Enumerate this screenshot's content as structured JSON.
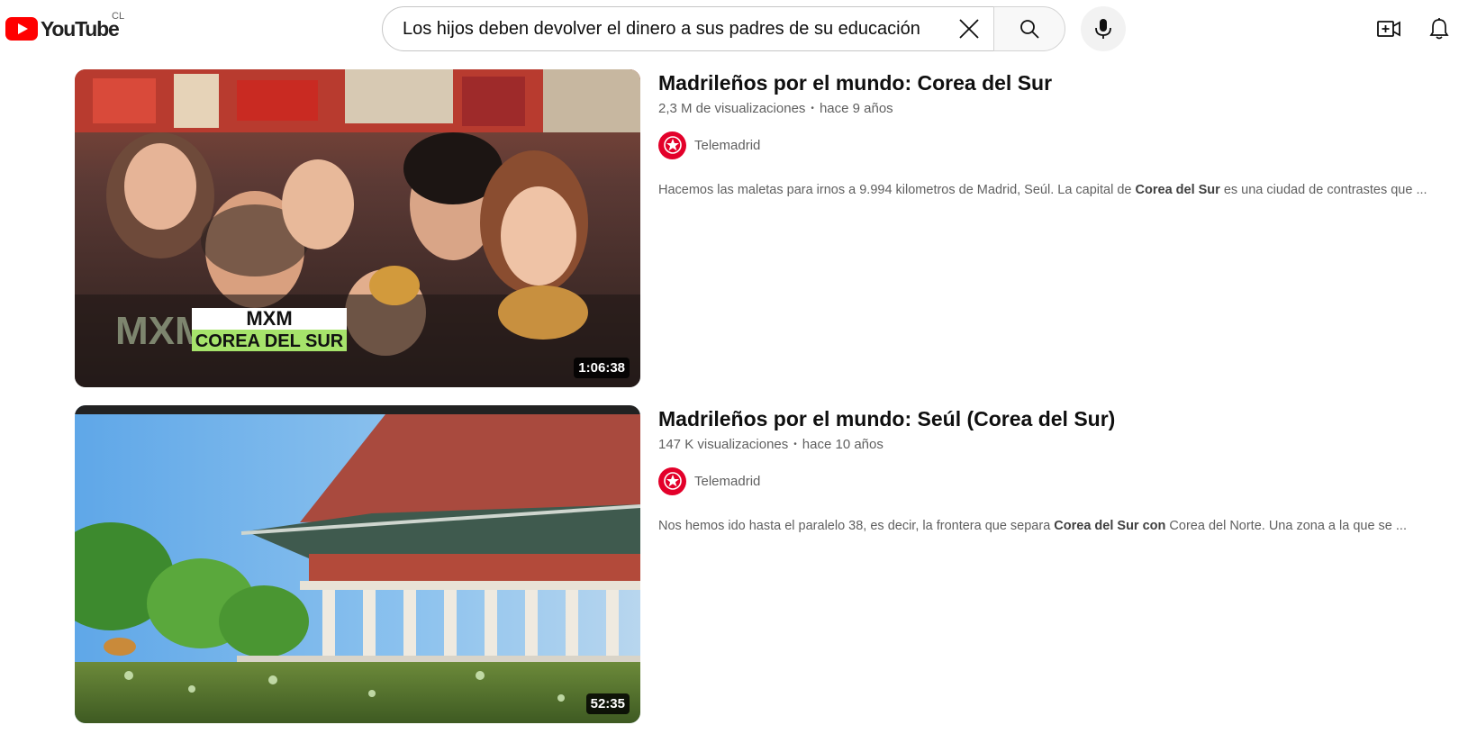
{
  "header": {
    "logo_text": "YouTube",
    "country_code": "CL",
    "search_value": "Los hijos deben devolver el dinero a sus padres de su educación",
    "icons": {
      "clear": "close-icon",
      "search": "search-icon",
      "mic": "microphone-icon",
      "create": "create-video-icon",
      "notifications": "bell-icon"
    }
  },
  "results": [
    {
      "title": "Madrileños por el mundo: Corea del Sur",
      "views": "2,3 M de visualizaciones",
      "age": "hace 9 años",
      "channel": "Telemadrid",
      "duration": "1:06:38",
      "thumbnail_overlay": {
        "line1": "MXM",
        "line2": "COREA DEL SUR",
        "watermark": "MXM"
      },
      "description": {
        "before": "Hacemos las maletas para irnos a 9.994 kilometros de Madrid, Seúl. La capital de ",
        "bold": "Corea del Sur",
        "after": " es una ciudad de contrastes que ..."
      }
    },
    {
      "title": "Madrileños por el mundo: Seúl (Corea del Sur)",
      "views": "147 K visualizaciones",
      "age": "hace 10 años",
      "channel": "Telemadrid",
      "duration": "52:35",
      "description": {
        "before": "Nos hemos ido hasta el paralelo 38, es decir, la frontera que separa ",
        "bold": "Corea del Sur con",
        "after": " Corea del Norte. Una zona a la que se ..."
      }
    }
  ],
  "colors": {
    "brand_red": "#ff0000",
    "channel_avatar": "#e3002a",
    "meta_text": "#606060"
  }
}
